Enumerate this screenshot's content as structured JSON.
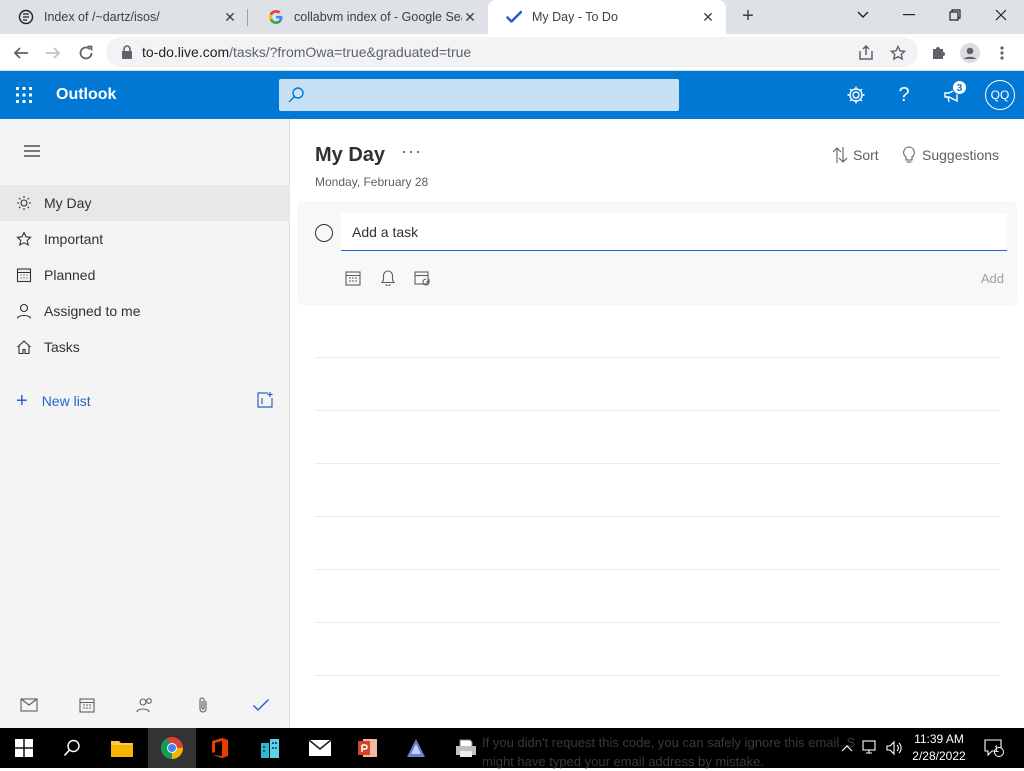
{
  "browser": {
    "tabs": [
      {
        "title": "Index of /~dartz/isos/"
      },
      {
        "title": "collabvm index of - Google Searc"
      },
      {
        "title": "My Day - To Do"
      }
    ],
    "url_host": "to-do.live.com",
    "url_path": "/tasks/?fromOwa=true&graduated=true"
  },
  "header": {
    "brand": "Outlook",
    "notification_count": "3",
    "avatar_initials": "QQ",
    "accent": "#0078d4"
  },
  "sidebar": {
    "items": [
      {
        "label": "My Day",
        "icon": "sun-icon"
      },
      {
        "label": "Important",
        "icon": "star-icon"
      },
      {
        "label": "Planned",
        "icon": "calendar-icon"
      },
      {
        "label": "Assigned to me",
        "icon": "person-icon"
      },
      {
        "label": "Tasks",
        "icon": "home-icon"
      }
    ],
    "new_list_label": "New list"
  },
  "main": {
    "title": "My Day",
    "date": "Monday, February 28",
    "sort_label": "Sort",
    "suggestions_label": "Suggestions",
    "add_task_placeholder": "Add a task",
    "add_button_label": "Add"
  },
  "taskbar": {
    "ghost_text_line1": "If you didn't request this code, you can safely ignore this email. S",
    "ghost_text_line2": "might have typed your email address by mistake.",
    "time": "11:39 AM",
    "date": "2/28/2022",
    "notification_count": "1"
  }
}
